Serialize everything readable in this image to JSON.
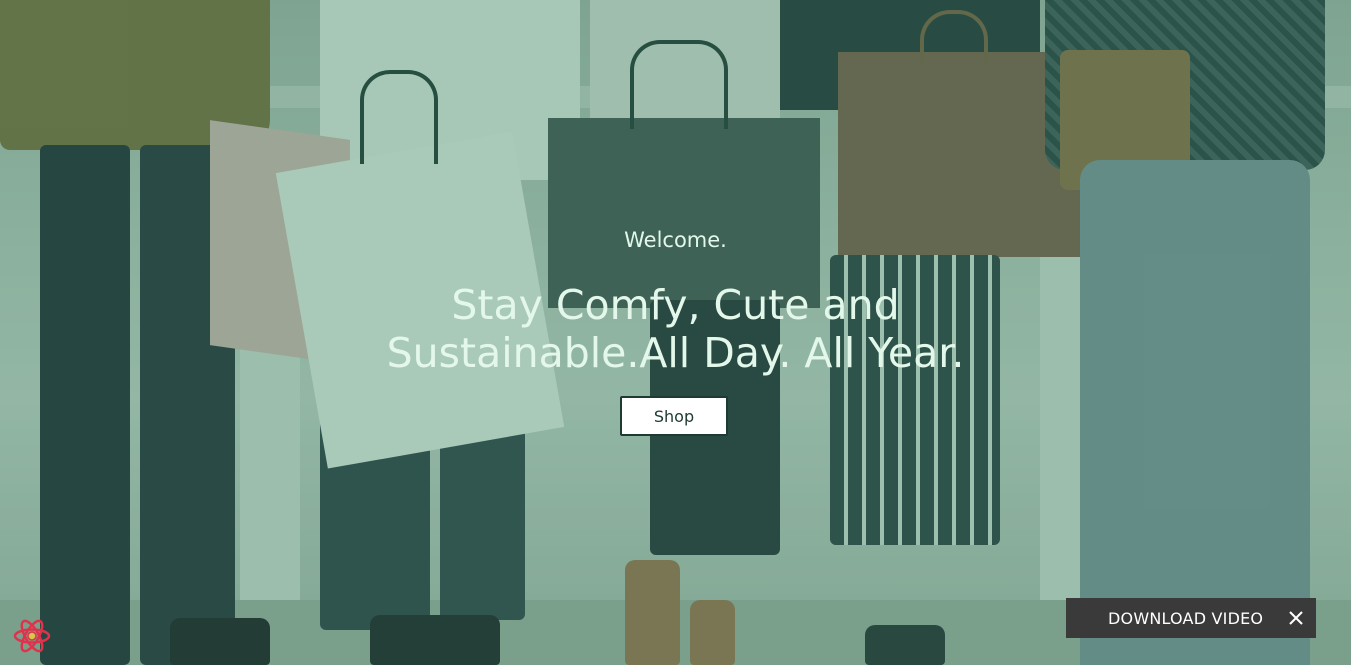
{
  "hero": {
    "welcome": "Welcome.",
    "headline_line1": "Stay Comfy, Cute and",
    "headline_line2": "Sustainable.All Day. All Year.",
    "shop_label": "Shop"
  },
  "download": {
    "label": "DOWNLOAD VIDEO",
    "close_icon": "close-icon"
  },
  "devtools": {
    "icon": "react-icon"
  },
  "colors": {
    "headline_text": "#e3f7ea",
    "button_border": "#1d3a33",
    "download_bg": "#3a3a3a",
    "react_icon": "#e0324a"
  }
}
